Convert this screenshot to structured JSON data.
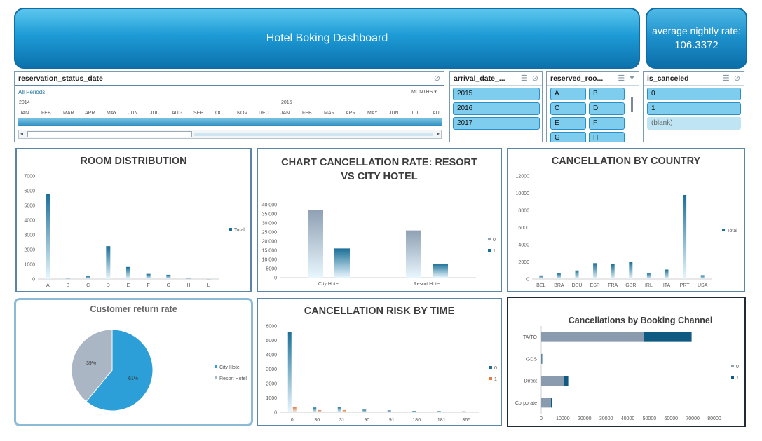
{
  "header": {
    "title": "Hotel Boking Dashboard"
  },
  "kpi": {
    "label": "average nightly rate:",
    "value": "106.3372"
  },
  "timeline": {
    "field": "reservation_status_date",
    "all_periods": "All Periods",
    "granularity": "MONTHS",
    "year1": "2014",
    "year2": "2015",
    "months": [
      "JAN",
      "FEB",
      "MAR",
      "APR",
      "MAY",
      "JUN",
      "JUL",
      "AUG",
      "SEP",
      "OCT",
      "NOV",
      "DEC",
      "JAN",
      "FEB",
      "MAR",
      "APR",
      "MAY",
      "JUN",
      "JUL",
      "AU"
    ]
  },
  "slicers": {
    "arrival": {
      "title": "arrival_date_...",
      "items": [
        "2015",
        "2016",
        "2017"
      ]
    },
    "reserved": {
      "title": "reserved_roo...",
      "items": [
        "A",
        "B",
        "C",
        "D",
        "E",
        "F",
        "G",
        "H"
      ]
    },
    "canceled": {
      "title": "is_canceled",
      "items": [
        "0",
        "1",
        "(blank)"
      ]
    }
  },
  "panels": {
    "room": "ROOM DISTRIBUTION",
    "rate": "CHART CANCELLATION RATE: RESORT VS CITY HOTEL",
    "country": "CANCELLATION BY COUNTRY",
    "return": "Customer return rate",
    "risk": "CANCELLATION RISK  BY TIME",
    "channel": "Cancellations by Booking Channel"
  },
  "chart_data": [
    {
      "type": "bar",
      "title": "ROOM DISTRIBUTION",
      "categories": [
        "A",
        "B",
        "C",
        "D",
        "E",
        "F",
        "G",
        "H",
        "L"
      ],
      "series": [
        {
          "name": "Total",
          "values": [
            5800,
            80,
            200,
            2230,
            820,
            350,
            290,
            70,
            0
          ]
        }
      ],
      "ylim": [
        0,
        7000
      ],
      "yticks": [
        0,
        1000,
        2000,
        3000,
        4000,
        5000,
        6000,
        7000
      ],
      "legend": "right",
      "color": "#1a6f97"
    },
    {
      "type": "bar",
      "title": "CHART CANCELLATION RATE: RESORT VS CITY HOTEL",
      "categories": [
        "City Hotel",
        "Resort Hotel"
      ],
      "series": [
        {
          "name": "0",
          "values": [
            37300,
            25900
          ]
        },
        {
          "name": "1",
          "values": [
            16000,
            7700
          ]
        }
      ],
      "ylim": [
        0,
        40000
      ],
      "yticks": [
        0,
        5000,
        10000,
        15000,
        20000,
        25000,
        30000,
        35000,
        40000
      ],
      "tick_labels": [
        "0",
        "5000",
        "10 000",
        "15 000",
        "20 000",
        "25 000",
        "30 000",
        "35 000",
        "40 000"
      ],
      "legend": "right",
      "colors": [
        "#8fa0b4",
        "#1a6f97"
      ]
    },
    {
      "type": "bar",
      "title": "CANCELLATION BY COUNTRY",
      "categories": [
        "BEL",
        "BRA",
        "DEU",
        "ESP",
        "FRA",
        "GBR",
        "IRL",
        "ITA",
        "PRT",
        "USA"
      ],
      "series": [
        {
          "name": "Total",
          "values": [
            420,
            680,
            1000,
            1850,
            1750,
            2000,
            720,
            1100,
            9800,
            450
          ]
        }
      ],
      "ylim": [
        0,
        12000
      ],
      "yticks": [
        0,
        2000,
        4000,
        6000,
        8000,
        10000,
        12000
      ],
      "legend": "right",
      "color": "#1a6f97"
    },
    {
      "type": "pie",
      "title": "Customer return rate",
      "series": [
        {
          "name": "",
          "values": [
            61,
            39
          ]
        }
      ],
      "labels": [
        "City Hotel",
        "Resort Hotel"
      ],
      "slice_labels": [
        "61%",
        "39%"
      ],
      "legend": "right",
      "colors": [
        "#2c9fd7",
        "#a9b5c3"
      ]
    },
    {
      "type": "bar",
      "title": "CANCELLATION RISK  BY TIME",
      "categories": [
        "0",
        "30",
        "31",
        "90",
        "91",
        "180",
        "181",
        "365"
      ],
      "series": [
        {
          "name": "0",
          "values": [
            5600,
            330,
            380,
            180,
            130,
            90,
            80,
            60
          ]
        },
        {
          "name": "1",
          "values": [
            350,
            150,
            150,
            40,
            40,
            30,
            30,
            20
          ]
        }
      ],
      "ylim": [
        0,
        6000
      ],
      "yticks": [
        0,
        500,
        1000,
        1500,
        2000,
        2500,
        3000,
        3500,
        4000,
        4500,
        5000,
        5500,
        6000
      ],
      "legend": "right",
      "colors": [
        "#1a6f97",
        "#e67a3c"
      ]
    },
    {
      "type": "bar",
      "orientation": "horizontal",
      "stacked": true,
      "title": "Cancellations by Booking Channel",
      "categories": [
        "Corporate",
        "Direct",
        "GDS",
        "TA/TO"
      ],
      "series": [
        {
          "name": "0",
          "values": [
            4500,
            10500,
            200,
            47500
          ]
        },
        {
          "name": "1",
          "values": [
            500,
            2000,
            100,
            22000
          ]
        }
      ],
      "xlim": [
        0,
        80000
      ],
      "xticks": [
        0,
        10000,
        20000,
        30000,
        40000,
        50000,
        60000,
        70000,
        80000
      ],
      "tick_labels": [
        "0",
        "10000",
        "20000",
        "30000",
        "40000",
        "50000",
        "60000",
        "70000",
        "80000"
      ],
      "legend": "right",
      "colors": [
        "#8fa0b4",
        "#0f5a80"
      ]
    }
  ]
}
